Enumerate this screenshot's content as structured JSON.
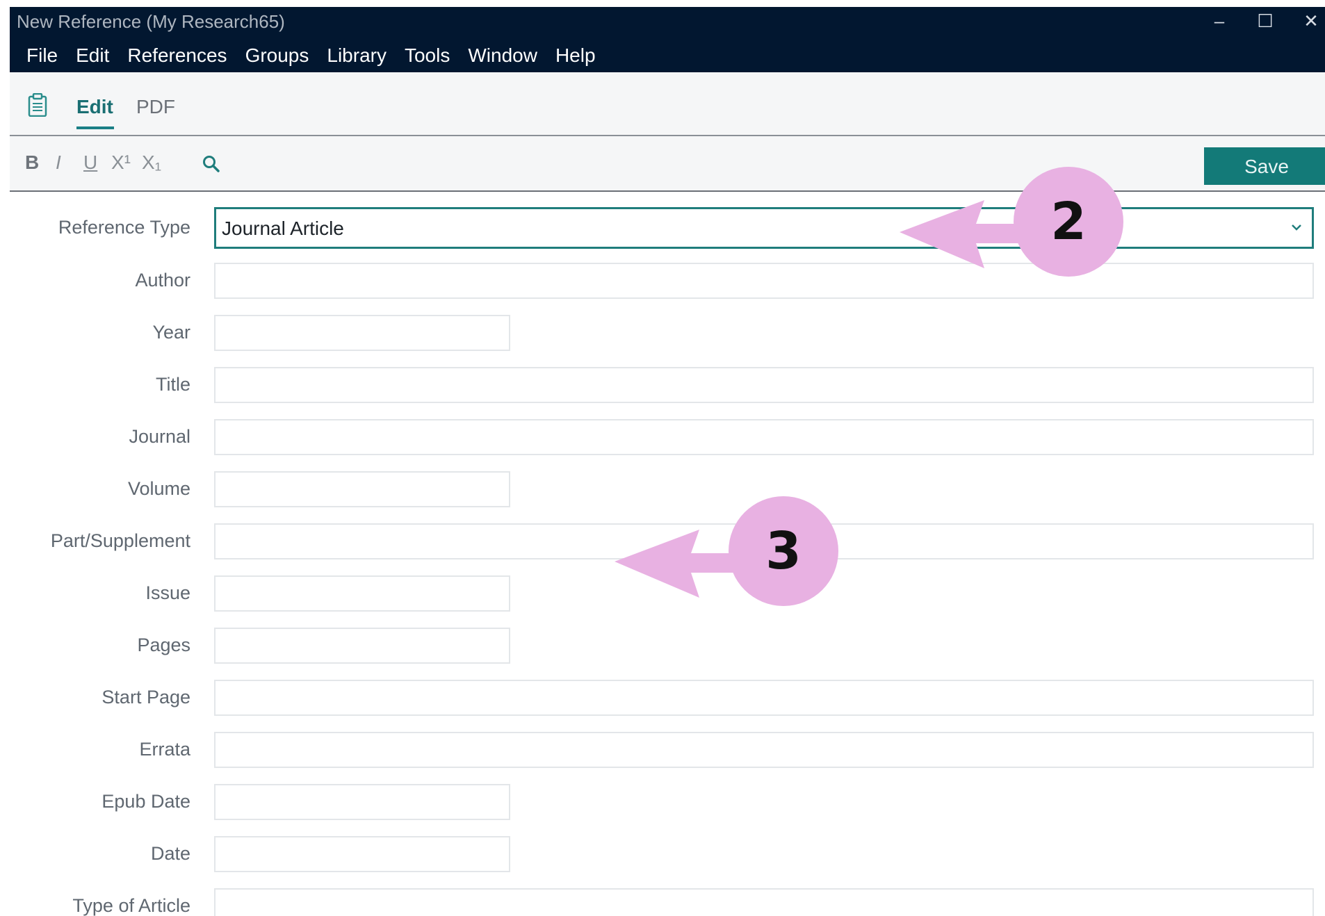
{
  "window": {
    "title": "New Reference (My Research65)",
    "controls": {
      "minimize": "–",
      "maximize": "☐",
      "close": "✕"
    }
  },
  "menu": [
    "File",
    "Edit",
    "References",
    "Groups",
    "Library",
    "Tools",
    "Window",
    "Help"
  ],
  "tabs": {
    "edit": "Edit",
    "pdf": "PDF"
  },
  "format_toolbar": {
    "bold": "B",
    "italic": "I",
    "underline": "U",
    "superscript": "X¹",
    "subscript": "X₁",
    "save_label": "Save"
  },
  "form": {
    "reference_type": {
      "label": "Reference Type",
      "value": "Journal Article"
    },
    "fields": [
      {
        "label": "Author",
        "value": ""
      },
      {
        "label": "Year",
        "value": ""
      },
      {
        "label": "Title",
        "value": ""
      },
      {
        "label": "Journal",
        "value": ""
      },
      {
        "label": "Volume",
        "value": ""
      },
      {
        "label": "Part/Supplement",
        "value": ""
      },
      {
        "label": "Issue",
        "value": ""
      },
      {
        "label": "Pages",
        "value": ""
      },
      {
        "label": "Start Page",
        "value": ""
      },
      {
        "label": "Errata",
        "value": ""
      },
      {
        "label": "Epub Date",
        "value": ""
      },
      {
        "label": "Date",
        "value": ""
      },
      {
        "label": "Type of Article",
        "value": ""
      }
    ]
  },
  "annotations": [
    "2",
    "3"
  ],
  "colors": {
    "titlebar": "#021730",
    "accent": "#137a78",
    "annotation": "#e8b1e2"
  }
}
